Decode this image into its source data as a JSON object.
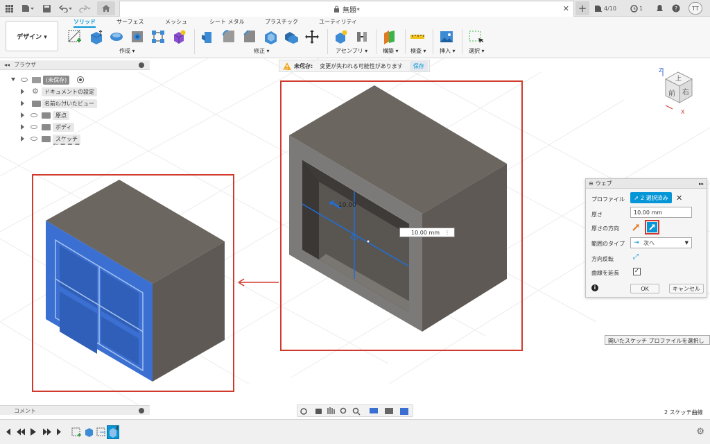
{
  "titlebar": {
    "doc_title": "無題*",
    "job_count": "4/10",
    "notif_count": "1",
    "user_initials": "TT"
  },
  "ribbon": {
    "workspace": "デザイン ▾",
    "tabs": [
      "ソリッド",
      "サーフェス",
      "メッシュ",
      "シート メタル",
      "プラスチック",
      "ユーティリティ"
    ],
    "groups": [
      "作成 ▾",
      "修正 ▾",
      "アセンブリ ▾",
      "構築 ▾",
      "検査 ▾",
      "挿入 ▾",
      "選択 ▾"
    ]
  },
  "browser": {
    "title": "ブラウザ",
    "root": "(未保存)",
    "items": [
      "ドキュメントの設定",
      "名前の付いたビュー",
      "原点",
      "ボディ",
      "スケッチ"
    ]
  },
  "warning": {
    "label": "未保存:",
    "message": "変更が失われる可能性があります",
    "save": "保存"
  },
  "viewcube": {
    "top": "上",
    "front": "前",
    "right": "右",
    "axis_z": "Z",
    "axis_x": "X"
  },
  "viewport": {
    "dim_input": "10.00 mm",
    "dim_label": "10.00"
  },
  "web_panel": {
    "title": "ウェブ",
    "rows": [
      "プロファイル",
      "厚さ",
      "厚さの方向",
      "範囲のタイプ",
      "方向反転",
      "曲線を延長"
    ],
    "profile_value": "2 選択済み",
    "thickness_value": "10.00 mm",
    "extent_value": "次へ",
    "ok": "OK",
    "cancel": "キャンセル"
  },
  "tooltip": "開いたスケッチ プロファイルを選択し",
  "comment": "コメント",
  "status": "2 スケッチ曲線",
  "colors": {
    "accent": "#0696d7",
    "highlight_frame": "#d0392b",
    "body_dark": "#5f5a54",
    "body_selected": "#3b6fd1"
  }
}
